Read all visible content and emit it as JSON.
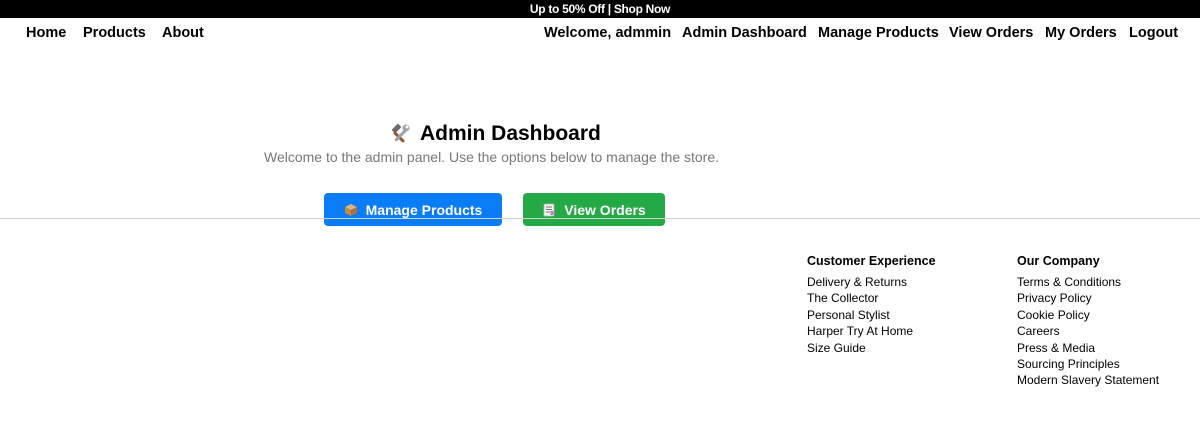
{
  "promo": {
    "text": "Up to 50% Off | Shop Now"
  },
  "nav": {
    "left": [
      "Home",
      "Products",
      "About"
    ],
    "welcome": "Welcome, admmin",
    "right": [
      "Admin Dashboard",
      "Manage Products",
      "View Orders",
      "My Orders",
      "Logout"
    ]
  },
  "dashboard": {
    "title": "Admin Dashboard",
    "title_icon": "tools-icon",
    "subtitle": "Welcome to the admin panel. Use the options below to manage the store.",
    "buttons": [
      {
        "label": "Manage Products",
        "icon": "package-icon",
        "color": "#0a7cf5"
      },
      {
        "label": "View Orders",
        "icon": "document-icon",
        "color": "#25a846"
      }
    ]
  },
  "footer": {
    "columns": [
      {
        "heading": "Customer Experience",
        "links": [
          "Delivery & Returns",
          "The Collector",
          "Personal Stylist",
          "Harper Try At Home",
          "Size Guide"
        ]
      },
      {
        "heading": "Our Company",
        "links": [
          "Terms & Conditions",
          "Privacy Policy",
          "Cookie Policy",
          "Careers",
          "Press & Media",
          "Sourcing Principles",
          "Modern Slavery Statement"
        ]
      }
    ]
  }
}
